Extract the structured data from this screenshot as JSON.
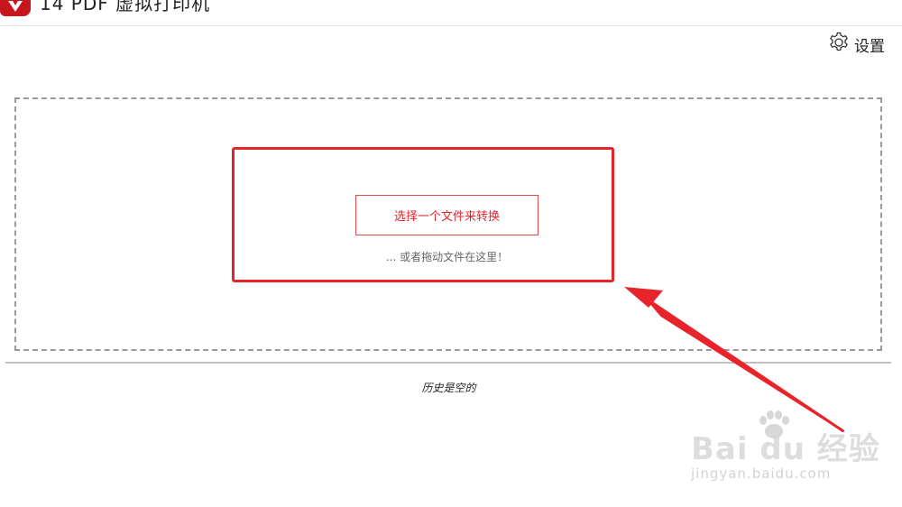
{
  "app": {
    "title": "14 PDF 虚拟打印机",
    "logo_icon": "app-logo-icon",
    "brand_color": "#c8161d"
  },
  "toolbar": {
    "settings_label": "设置",
    "settings_icon": "gear-icon"
  },
  "dropzone": {
    "choose_button_label": "选择一个文件来转换",
    "drop_hint": "... 或者拖动文件在这里！",
    "highlight_color": "#e8242b"
  },
  "history": {
    "empty_text": "历史是空的"
  },
  "watermark": {
    "main": "Bai du 经验",
    "sub": "jingyan.baidu.com"
  }
}
